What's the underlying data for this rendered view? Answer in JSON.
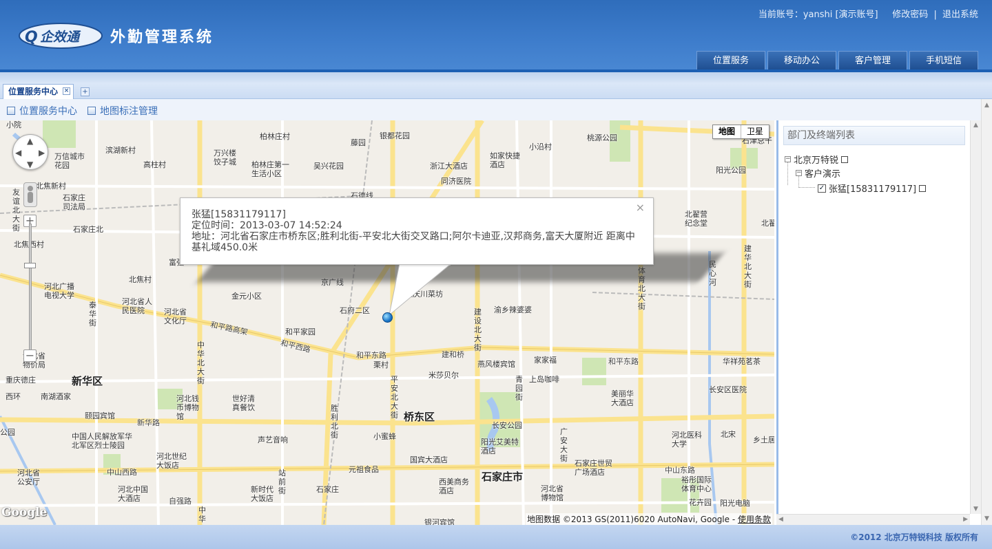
{
  "header": {
    "logo_text": "企效通",
    "app_title": "外勤管理系统",
    "account_label": "当前账号：yanshi [演示账号]",
    "change_password": "修改密码",
    "separator": "|",
    "logout": "退出系统",
    "nav": [
      "位置服务",
      "移动办公",
      "客户管理",
      "手机短信"
    ]
  },
  "tabs": {
    "active_tab": "位置服务中心",
    "close_glyph": "×",
    "add_glyph": "+"
  },
  "subbar": {
    "links": [
      "位置服务中心",
      "地图标注管理"
    ]
  },
  "map": {
    "type_buttons": [
      "地图",
      "卫星"
    ],
    "google_logo": "Google",
    "attribution_prefix": "地图数据 ©2013 GS(2011)6020 AutoNavi, Google - ",
    "attribution_link": "使用条款",
    "labels": {
      "district_xinhua": "新华区",
      "district_qiaodong": "桥东区",
      "city_shijiazhuang": "石家庄市",
      "l1": "万信城市花园",
      "l2": "滨湖新村",
      "l3": "高柱村",
      "l4": "万兴楼饺子城",
      "l5": "柏林庄村",
      "l6": "柏林庄第一生活小区",
      "l7": "吴兴花园",
      "l8": "藤园",
      "l9": "银都花园",
      "l10": "浙江大酒店",
      "l11": "同济医院",
      "l12": "如家快捷酒店",
      "l13": "小沿村",
      "l14": "桃源公园",
      "l15": "阳光公园",
      "l16": "北翟营纪念堂",
      "l17": "北焦新村",
      "l18": "石家庄司法局",
      "l19": "石家庄北",
      "l20": "北焦西村",
      "l21": "北焦村",
      "l22": "河北广播电视大学",
      "l23": "河北省人民医院",
      "l24": "河北省文化厅",
      "l25": "金元小区",
      "l26": "京广线",
      "l27": "石府二区",
      "l28": "渝乡辣婆婆",
      "l29": "和平东路",
      "l30": "建和桥",
      "l31": "燕风楼宾馆",
      "l32": "家家福",
      "l33": "和平东路",
      "l34": "华祥苑茗茶",
      "l35": "栗村",
      "l36": "米莎贝尔",
      "l37": "上岛咖啡",
      "l38": "美丽华大酒店",
      "l39": "长安区医院",
      "l40": "重庆德庄",
      "l41": "西环",
      "l42": "南湖酒家",
      "l43": "河北钱币博物馆",
      "l44": "世好清真餐饮",
      "l45": "颐园宾馆",
      "l46": "新华路",
      "l47": "中国人民解放军华北军区烈士陵园",
      "l48": "声艺音响",
      "l49": "小蜜蜂",
      "l50": "长安公园",
      "l51": "阳光艾美特酒店",
      "l52": "河北医科大学",
      "l53": "北宋",
      "l54": "乡土居",
      "l55": "河北世纪大饭店",
      "l56": "国宾大酒店",
      "l57": "元祖食品",
      "l58": "石家庄世贸广场酒店",
      "l59": "中山东路",
      "l60": "裕彤国际体育中心",
      "l61": "中山西路",
      "l62": "河北省公安厅",
      "l63": "河北中国大酒店",
      "l64": "自强路",
      "l65": "新时代大饭店",
      "l66": "石家庄",
      "l67": "西美商务酒店",
      "l68": "河北省博物馆",
      "l69": "花卉园",
      "l70": "阳光电脑",
      "l71": "银河宾馆",
      "l72": "石津总干",
      "l73": "重庆川菜坊",
      "l74": "和平路高架",
      "l75": "和平西路",
      "l76": "和平家园",
      "l77": "北翟",
      "l78": "友谊北大街",
      "l79": "建华北大街",
      "l80": "体育北大街",
      "l81": "建设北大街",
      "l82": "中华北大街",
      "l83": "胜利北街",
      "l84": "平安北大街",
      "l85": "青园街",
      "l86": "广安大街",
      "l87": "泰华街",
      "l88": "站前街",
      "l89": "民心河",
      "l90": "富强",
      "l91": "公园",
      "l92": "小院",
      "l93": "河北省物价局",
      "l94": "石德线",
      "l95": "中华"
    }
  },
  "infowindow": {
    "name": "张猛[15831179117]",
    "time": "定位时间：2013-03-07 14:52:24",
    "address": "地址：河北省石家庄市桥东区;胜利北街-平安北大街交叉路口;阿尔卡迪亚,汉邦商务,富天大厦附近 距离中基礼域450.0米",
    "close": "×"
  },
  "panel": {
    "title": "部门及终端列表",
    "tree": {
      "root": "北京万特锐",
      "group": "客户演示",
      "leaf": "张猛[15831179117]",
      "collapse_glyph": "−",
      "check_glyph": "✓"
    }
  },
  "footer": {
    "copyright": "©2012 北京万特锐科技 版权所有"
  },
  "colors": {
    "header_blue": "#3d7ccb",
    "road_yellow": "#fbe38e",
    "park_green": "#cfe6b4",
    "water_blue": "#a8c8f0",
    "link_blue": "#3a6fb8"
  }
}
